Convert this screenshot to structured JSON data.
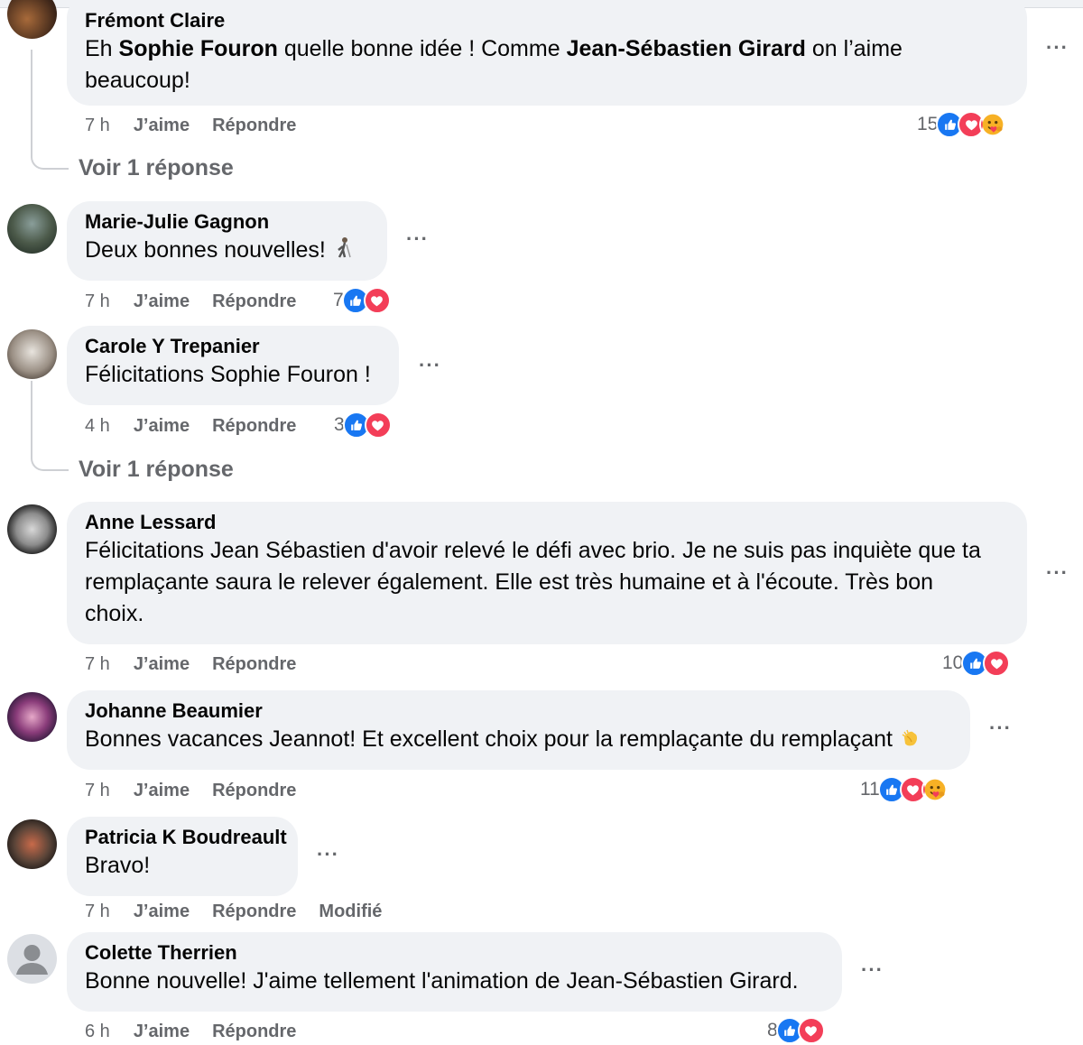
{
  "comments": [
    {
      "author": "Frémont Claire",
      "text_parts": [
        "Eh ",
        "Sophie Fouron",
        " quelle bonne idée ! Comme ",
        "Jean-Sébastien Girard",
        " on l’aime beaucoup!"
      ],
      "time": "7 h",
      "like": "J’aime",
      "reply": "Répondre",
      "reaction_count": "15",
      "reactions": [
        "like-icon",
        "love-icon",
        "care-icon"
      ],
      "view_replies": "Voir 1 réponse"
    },
    {
      "author": "Marie-Julie Gagnon",
      "text": "Deux bonnes nouvelles!",
      "emoji": "golfer-emoji",
      "time": "7 h",
      "like": "J’aime",
      "reply": "Répondre",
      "reaction_count": "7",
      "reactions": [
        "like-icon",
        "love-icon"
      ]
    },
    {
      "author": "Carole Y Trepanier",
      "text": "Félicitations Sophie Fouron !",
      "time": "4 h",
      "like": "J’aime",
      "reply": "Répondre",
      "reaction_count": "3",
      "reactions": [
        "like-icon",
        "love-icon"
      ],
      "view_replies": "Voir 1 réponse"
    },
    {
      "author": "Anne Lessard",
      "text_lines": [
        "Félicitations Jean Sébastien d'avoir relevé le défi avec brio. Je ne suis pas inquiète que ta",
        "remplaçante saura le relever également. Elle est très humaine et à l'écoute. Très bon",
        "choix."
      ],
      "time": "7 h",
      "like": "J’aime",
      "reply": "Répondre",
      "reaction_count": "10",
      "reactions": [
        "like-icon",
        "love-icon"
      ]
    },
    {
      "author": "Johanne Beaumier",
      "text": "Bonnes vacances Jeannot! Et excellent choix pour la remplaçante du remplaçant",
      "emoji": "clapping-hands-emoji",
      "time": "7 h",
      "like": "J’aime",
      "reply": "Répondre",
      "reaction_count": "11",
      "reactions": [
        "like-icon",
        "love-icon",
        "care-icon"
      ]
    },
    {
      "author": "Patricia K Boudreault",
      "text": "Bravo!",
      "time": "7 h",
      "like": "J’aime",
      "reply": "Répondre",
      "edited": "Modifié"
    },
    {
      "author": "Colette Therrien",
      "text": "Bonne nouvelle! J'aime tellement l'animation de Jean-Sébastien Girard.",
      "time": "6 h",
      "like": "J’aime",
      "reply": "Répondre",
      "reaction_count": "8",
      "reactions": [
        "like-icon",
        "love-icon"
      ]
    }
  ],
  "more_label": "···",
  "colors": {
    "bubble": "#f0f2f5",
    "meta_text": "#65676b",
    "like": "#1877f2",
    "love": "#f33e58",
    "care": "#f7b125"
  }
}
